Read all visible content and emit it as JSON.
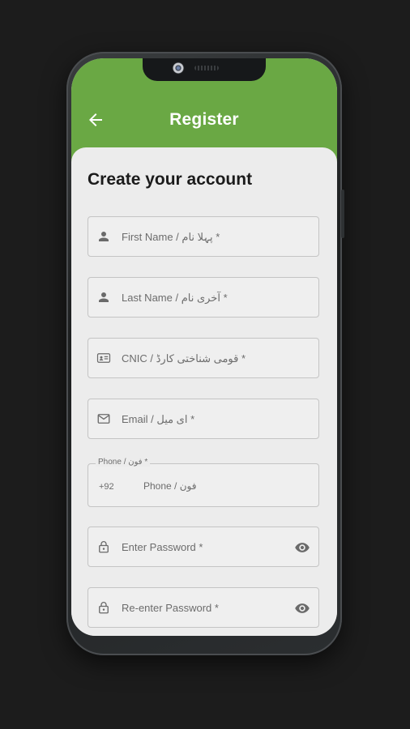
{
  "appbar": {
    "title": "Register",
    "color": "#6aa844"
  },
  "form": {
    "heading": "Create your account",
    "fields": {
      "first_name": {
        "placeholder": "First Name / پہلا نام *",
        "icon": "person-icon"
      },
      "last_name": {
        "placeholder": "Last Name / آخری نام *",
        "icon": "person-icon"
      },
      "cnic": {
        "placeholder": "CNIC / قومی شناختی کارڈ *",
        "icon": "id-card-icon"
      },
      "email": {
        "placeholder": "Email / ای میل *",
        "icon": "mail-icon"
      },
      "phone": {
        "label": "Phone / فون *",
        "country_code": "+92",
        "placeholder": "Phone / فون"
      },
      "password": {
        "placeholder": "Enter Password *",
        "icon": "lock-icon",
        "toggle_icon": "eye-icon"
      },
      "confirm_password": {
        "placeholder": "Re-enter Password *",
        "icon": "lock-icon",
        "toggle_icon": "eye-icon"
      }
    }
  }
}
